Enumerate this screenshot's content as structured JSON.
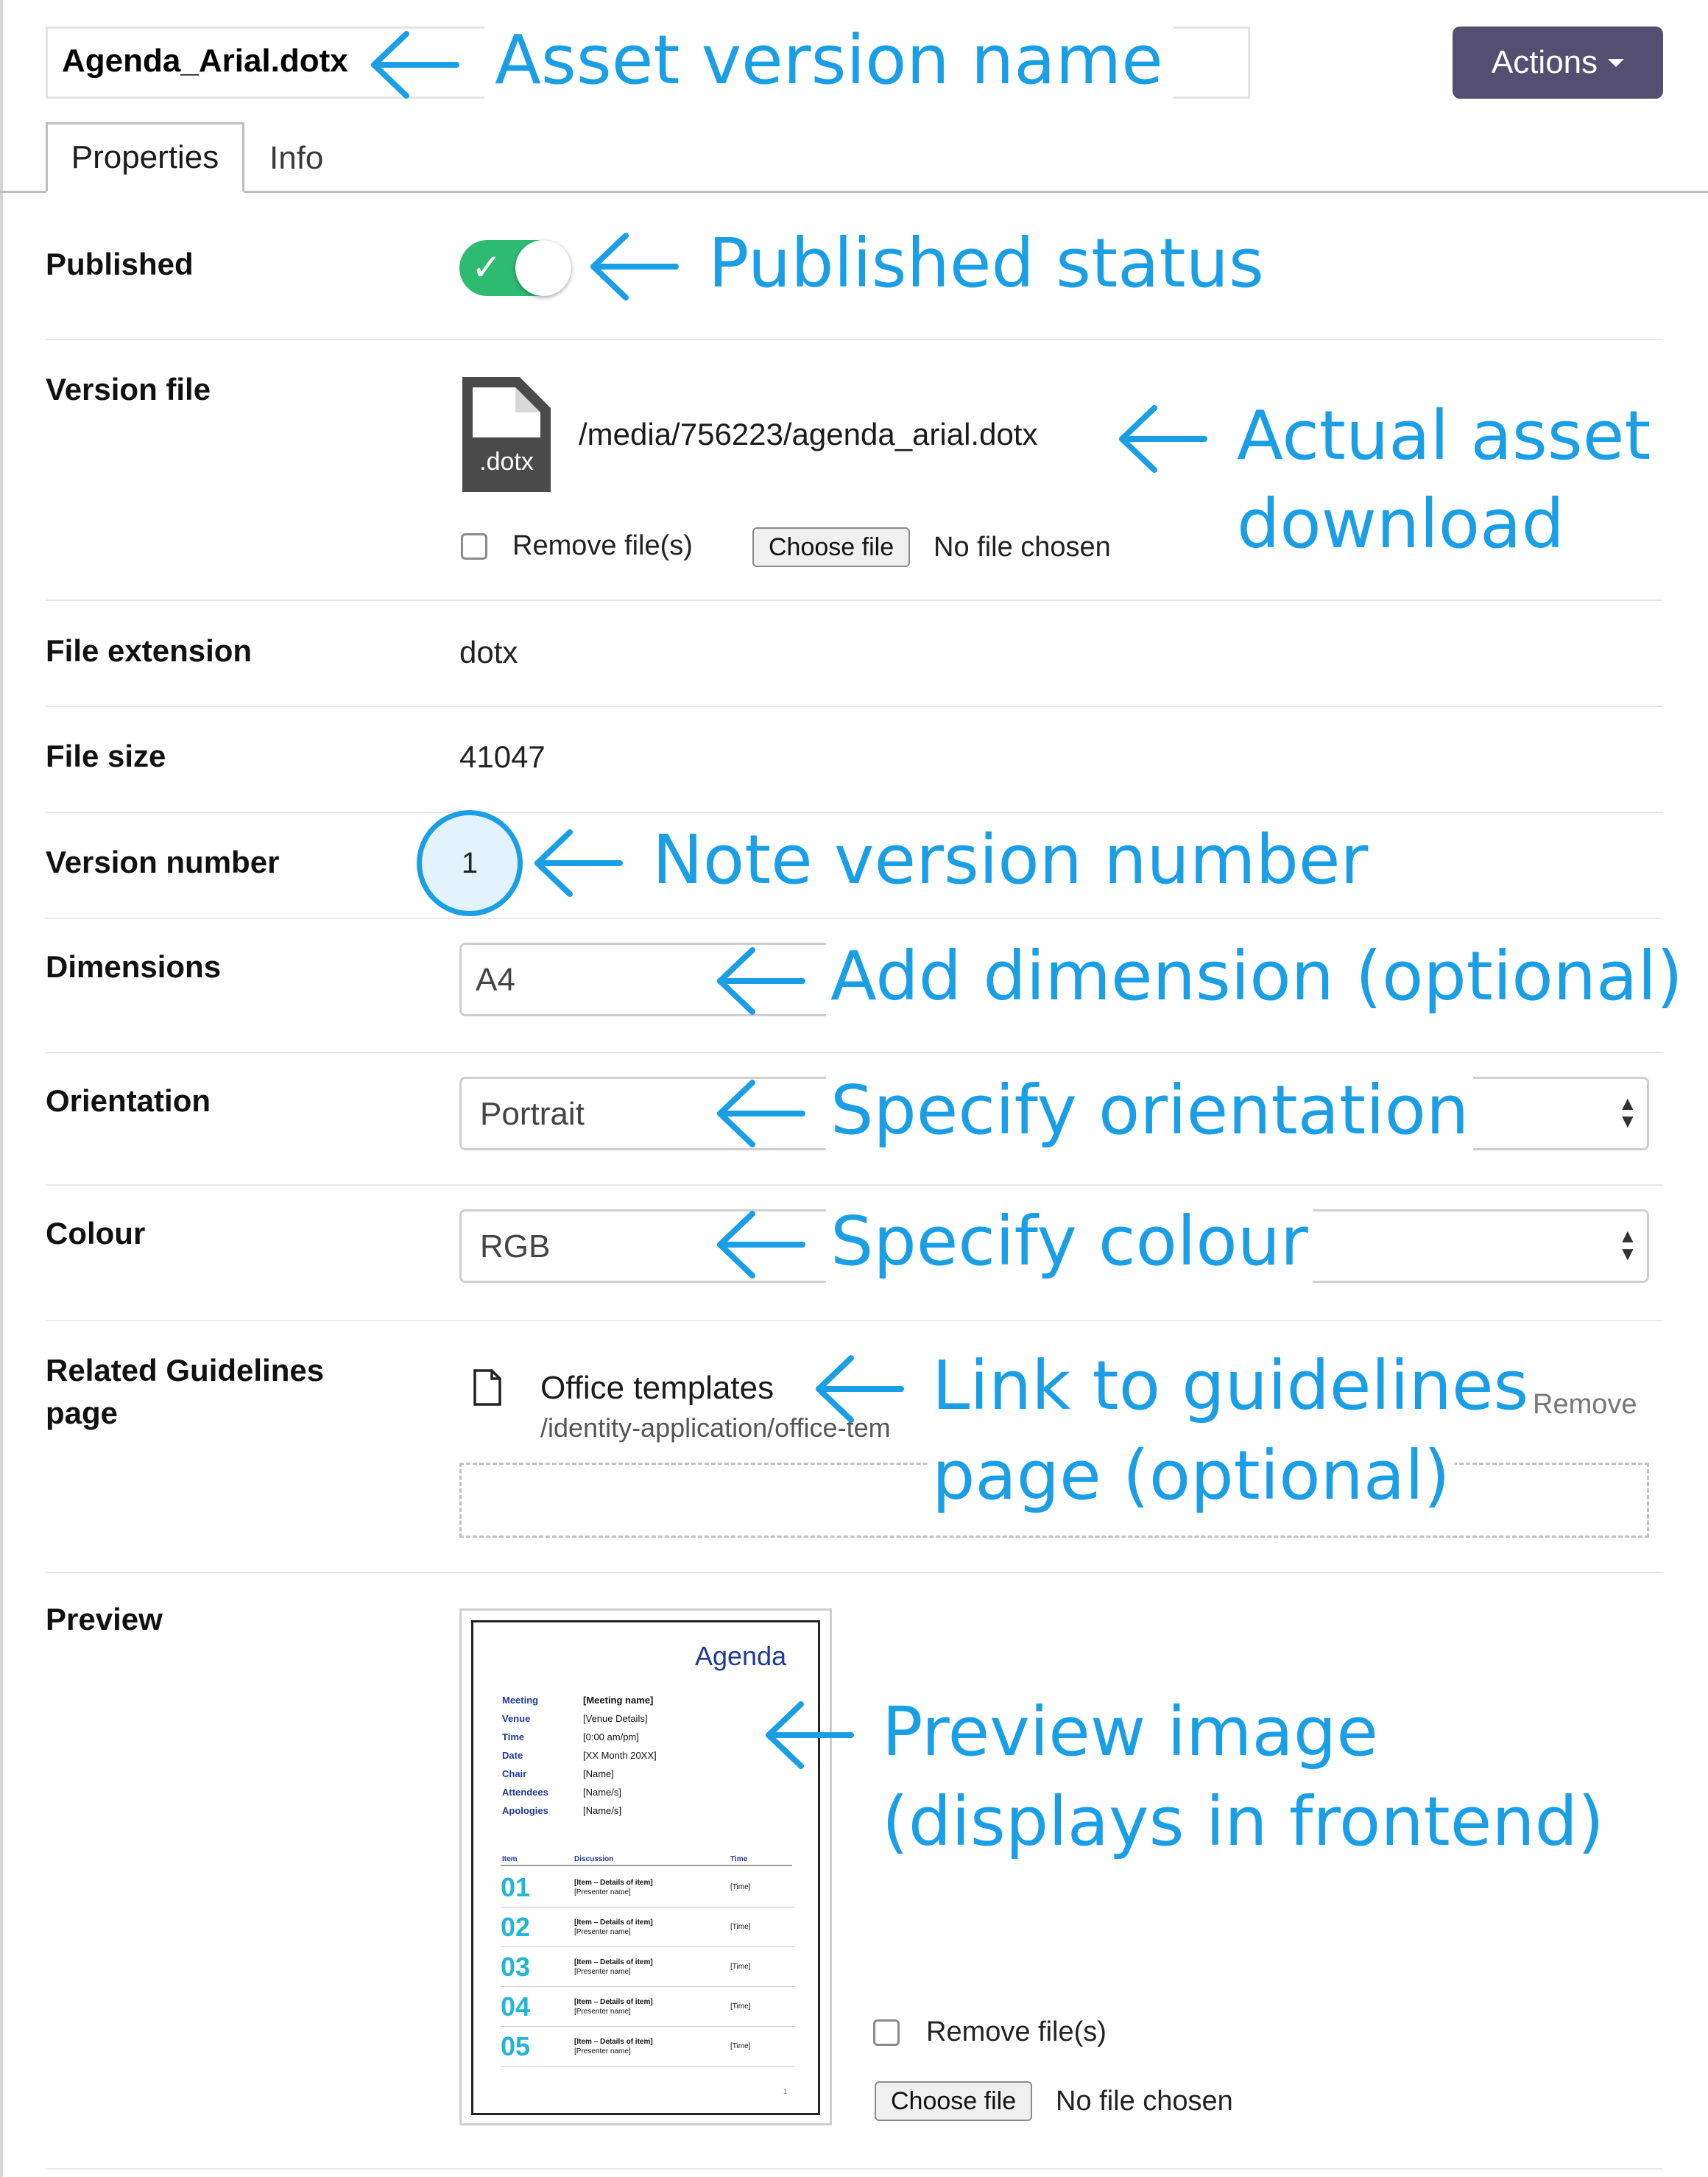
{
  "header": {
    "asset_name": "Agenda_Arial.dotx",
    "actions_label": "Actions"
  },
  "tabs": [
    {
      "label": "Properties",
      "active": true
    },
    {
      "label": "Info",
      "active": false
    }
  ],
  "fields": {
    "published": {
      "label": "Published",
      "on": true
    },
    "version_file": {
      "label": "Version file",
      "icon_ext": ".dotx",
      "path": "/media/756223/agenda_arial.dotx",
      "remove_label": "Remove file(s)",
      "choose_label": "Choose file",
      "no_file": "No file chosen"
    },
    "file_extension": {
      "label": "File extension",
      "value": "dotx"
    },
    "file_size": {
      "label": "File size",
      "value": "41047"
    },
    "version_number": {
      "label": "Version number",
      "value": "1"
    },
    "dimensions": {
      "label": "Dimensions",
      "value": "A4"
    },
    "orientation": {
      "label": "Orientation",
      "value": "Portrait"
    },
    "colour": {
      "label": "Colour",
      "value": "RGB"
    },
    "related": {
      "label": "Related Guidelines page",
      "title": "Office templates",
      "path": "/identity-application/office-tem",
      "remove_label": "Remove"
    },
    "preview": {
      "label": "Preview",
      "remove_label": "Remove file(s)",
      "choose_label": "Choose file",
      "no_file": "No file chosen"
    }
  },
  "preview_doc": {
    "title": "Agenda",
    "meta_labels": [
      "Meeting",
      "Venue",
      "Time",
      "Date",
      "Chair",
      "Attendees",
      "Apologies"
    ],
    "meta_values": [
      "[Meeting name]",
      "[Venue Details]",
      "[0:00 am/pm]",
      "[XX Month 20XX]",
      "[Name]",
      "[Name/s]",
      "[Name/s]"
    ],
    "table_headers": [
      "Item",
      "Discussion",
      "Time"
    ],
    "items": [
      {
        "num": "01",
        "line1": "[Item – Details of item]",
        "line2": "[Presenter name]",
        "time": "[Time]"
      },
      {
        "num": "02",
        "line1": "[Item – Details of item]",
        "line2": "[Presenter name]",
        "time": "[Time]"
      },
      {
        "num": "03",
        "line1": "[Item – Details of item]",
        "line2": "[Presenter name]",
        "time": "[Time]"
      },
      {
        "num": "04",
        "line1": "[Item – Details of item]",
        "line2": "[Presenter name]",
        "time": "[Time]"
      },
      {
        "num": "05",
        "line1": "[Item – Details of item]",
        "line2": "[Presenter name]",
        "time": "[Time]"
      }
    ],
    "page_number": "1"
  },
  "annotations": {
    "asset_version_name": "Asset version name",
    "published_status": "Published status",
    "actual_asset_line1": "Actual asset",
    "actual_asset_line2": "download",
    "note_version": "Note version number",
    "add_dimension": "Add dimension (optional)",
    "specify_orientation": "Specify orientation",
    "specify_colour": "Specify colour",
    "link_guidelines_line1": "Link to guidelines",
    "link_guidelines_line2": "page (optional)",
    "preview_line1": "Preview image",
    "preview_line2": "(displays in frontend)"
  },
  "colors": {
    "annotation_blue": "#1a9fe6",
    "actions_bg": "#544f70",
    "toggle_on": "#2dbb72"
  }
}
